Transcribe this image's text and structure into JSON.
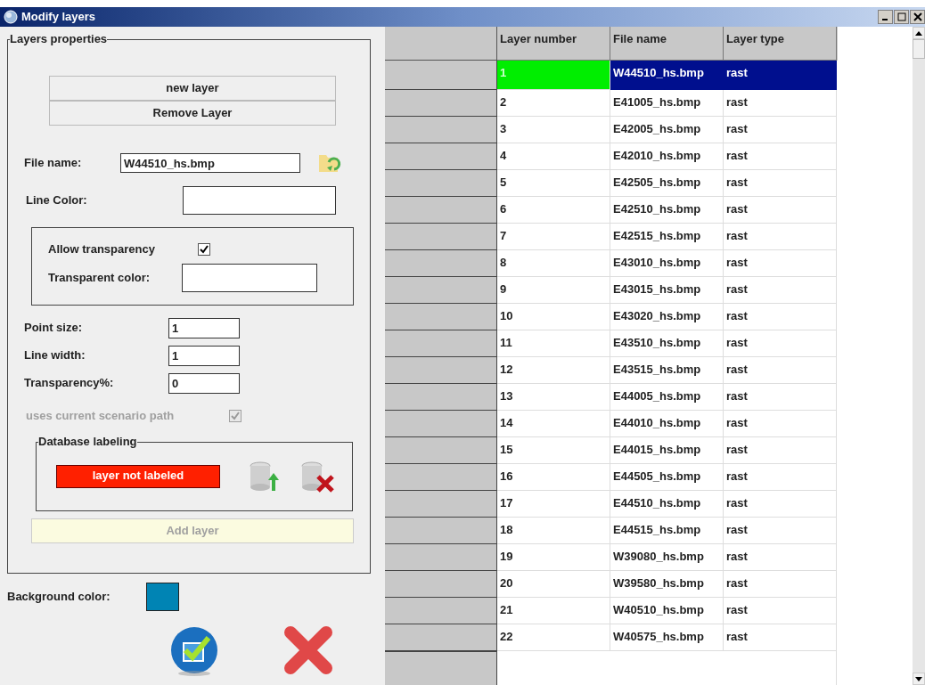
{
  "window": {
    "title": "Modify layers"
  },
  "properties": {
    "title": "Layers properties",
    "buttons": [
      {
        "label": "new layer"
      },
      {
        "label": "Remove Layer"
      }
    ],
    "file_name": {
      "label": "File name:",
      "value": "W44510_hs.bmp"
    },
    "line_color": {
      "label": "Line Color:"
    },
    "allow_transparency": {
      "label": "Allow transparency",
      "checked": true
    },
    "transparent_color": {
      "label": "Transparent color:"
    },
    "point_size": {
      "label": "Point size:",
      "value": "1"
    },
    "line_width": {
      "label": "Line width:",
      "value": "1"
    },
    "transparency": {
      "label": "Transparency%:",
      "value": "0"
    },
    "scenario_path": {
      "label": "uses current scenario path",
      "checked": true,
      "disabled": true
    },
    "database": {
      "title": "Database labeling",
      "status": "layer not labeled",
      "color": "#ff2000"
    },
    "add_button": {
      "label": "Add layer",
      "disabled": true
    }
  },
  "background": {
    "label": "Background color:",
    "color": "#0084b4"
  },
  "table": {
    "columns": [
      "Layer number",
      "File name",
      "Layer type"
    ],
    "rows": [
      {
        "number": "1",
        "file": "W44510_hs.bmp",
        "type": "rast",
        "selected": true
      },
      {
        "number": "2",
        "file": "E41005_hs.bmp",
        "type": "rast",
        "selected": false
      },
      {
        "number": "3",
        "file": "E42005_hs.bmp",
        "type": "rast",
        "selected": false
      },
      {
        "number": "4",
        "file": "E42010_hs.bmp",
        "type": "rast",
        "selected": false
      },
      {
        "number": "5",
        "file": "E42505_hs.bmp",
        "type": "rast",
        "selected": false
      },
      {
        "number": "6",
        "file": "E42510_hs.bmp",
        "type": "rast",
        "selected": false
      },
      {
        "number": "7",
        "file": "E42515_hs.bmp",
        "type": "rast",
        "selected": false
      },
      {
        "number": "8",
        "file": "E43010_hs.bmp",
        "type": "rast",
        "selected": false
      },
      {
        "number": "9",
        "file": "E43015_hs.bmp",
        "type": "rast",
        "selected": false
      },
      {
        "number": "10",
        "file": "E43020_hs.bmp",
        "type": "rast",
        "selected": false
      },
      {
        "number": "11",
        "file": "E43510_hs.bmp",
        "type": "rast",
        "selected": false
      },
      {
        "number": "12",
        "file": "E43515_hs.bmp",
        "type": "rast",
        "selected": false
      },
      {
        "number": "13",
        "file": "E44005_hs.bmp",
        "type": "rast",
        "selected": false
      },
      {
        "number": "14",
        "file": "E44010_hs.bmp",
        "type": "rast",
        "selected": false
      },
      {
        "number": "15",
        "file": "E44015_hs.bmp",
        "type": "rast",
        "selected": false
      },
      {
        "number": "16",
        "file": "E44505_hs.bmp",
        "type": "rast",
        "selected": false
      },
      {
        "number": "17",
        "file": "E44510_hs.bmp",
        "type": "rast",
        "selected": false
      },
      {
        "number": "18",
        "file": "E44515_hs.bmp",
        "type": "rast",
        "selected": false
      },
      {
        "number": "19",
        "file": "W39080_hs.bmp",
        "type": "rast",
        "selected": false
      },
      {
        "number": "20",
        "file": "W39580_hs.bmp",
        "type": "rast",
        "selected": false
      },
      {
        "number": "21",
        "file": "W40510_hs.bmp",
        "type": "rast",
        "selected": false
      },
      {
        "number": "22",
        "file": "W40575_hs.bmp",
        "type": "rast",
        "selected": false
      }
    ]
  }
}
